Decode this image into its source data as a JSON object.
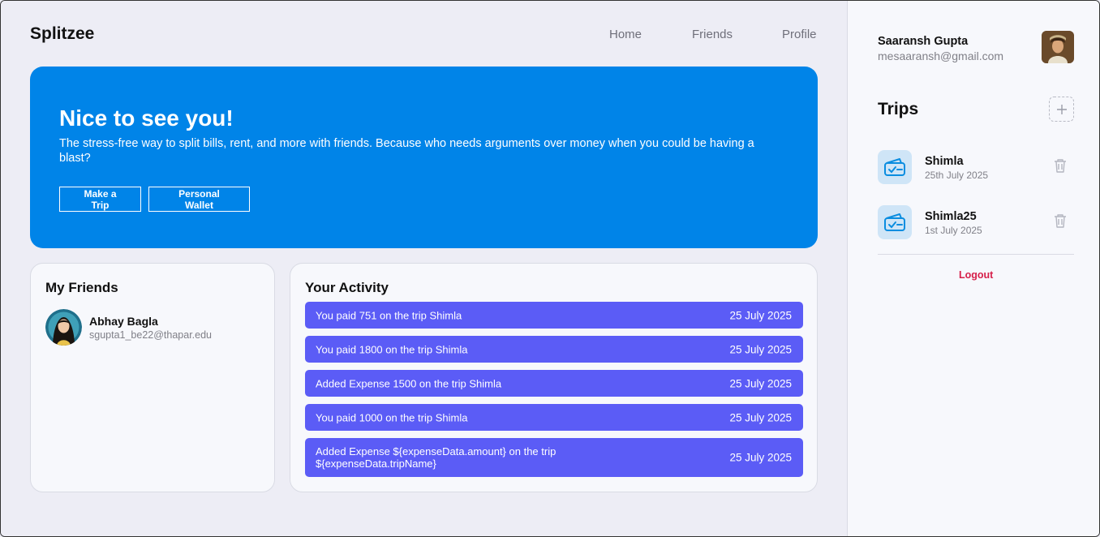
{
  "app": {
    "brand": "Splitzee"
  },
  "nav": {
    "home": "Home",
    "friends": "Friends",
    "profile": "Profile"
  },
  "hero": {
    "title": "Nice to see you!",
    "text": "The stress-free way to split bills, rent, and more with friends. Because who needs arguments over money when you could be having a blast?",
    "make_trip_label": "Make a Trip",
    "wallet_label": "Personal Wallet"
  },
  "friends": {
    "title": "My Friends",
    "items": [
      {
        "name": "Abhay Bagla",
        "email": "sgupta1_be22@thapar.edu"
      }
    ]
  },
  "activity": {
    "title": "Your Activity",
    "items": [
      {
        "text": "You paid 751 on the trip Shimla",
        "date": "25 July 2025"
      },
      {
        "text": "You paid 1800 on the trip Shimla",
        "date": "25 July 2025"
      },
      {
        "text": "Added Expense 1500 on the trip Shimla",
        "date": "25 July 2025"
      },
      {
        "text": "You paid 1000 on the trip Shimla",
        "date": "25 July 2025"
      },
      {
        "text": "Added Expense ${expenseData.amount} on the trip ${expenseData.tripName}",
        "date": "25 July 2025"
      }
    ]
  },
  "user": {
    "name": "Saaransh Gupta",
    "email": "mesaaransh@gmail.com"
  },
  "trips": {
    "title": "Trips",
    "items": [
      {
        "name": "Shimla",
        "date": "25th July 2025"
      },
      {
        "name": "Shimla25",
        "date": "1st July 2025"
      }
    ]
  },
  "logout_label": "Logout",
  "colors": {
    "primary": "#0084e8",
    "activity": "#5b5cf6",
    "logout": "#d6204a",
    "trip_icon_bg": "#cfe5f7"
  },
  "icons": {
    "add": "plus-icon",
    "trip": "ticket-icon",
    "delete": "trash-icon"
  }
}
